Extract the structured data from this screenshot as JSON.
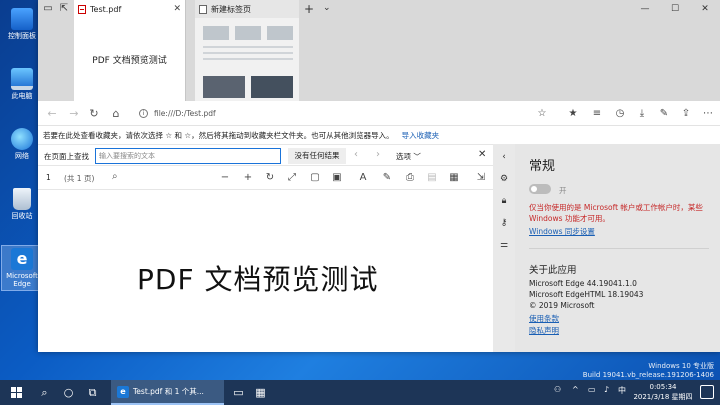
{
  "desktop": {
    "icons": [
      {
        "label": "控制面板",
        "icon": "control-panel-icon"
      },
      {
        "label": "此电脑",
        "icon": "this-pc-icon"
      },
      {
        "label": "网络",
        "icon": "network-icon"
      },
      {
        "label": "回收站",
        "icon": "recycle-bin-icon"
      },
      {
        "label": "Microsoft Edge",
        "icon": "edge-icon"
      }
    ]
  },
  "tabs": [
    {
      "title": "Test.pdf",
      "preview_text": "PDF 文档预览测试"
    },
    {
      "title": "新建标签页"
    }
  ],
  "address": {
    "url": "file:///D:/Test.pdf"
  },
  "favorites_bar": {
    "message": "若要在此处查看收藏夹，请依次选择 ☆ 和 ☆，然后将其拖动到收藏夹栏文件夹。也可从其他浏览器导入。",
    "import_link": "导入收藏夹"
  },
  "find_bar": {
    "label": "在页面上查找",
    "placeholder": "输入要搜索的文本",
    "result": "没有任何结果",
    "options": "选项 ﹀"
  },
  "pdf_toolbar": {
    "page_number": "1",
    "page_total": "(共 1 页)"
  },
  "pdf": {
    "content": "PDF 文档预览测试"
  },
  "settings": {
    "title": "常规",
    "toggle_label": "开",
    "warning": "仅当你使用的是 Microsoft 帐户或工作帐户时，某些 Windows 功能才可用。",
    "sync_link": "Windows 同步设置",
    "about_title": "关于此应用",
    "edge_version": "Microsoft Edge 44.19041.1.0",
    "edgehtml_version": "Microsoft EdgeHTML 18.19043",
    "copyright": "© 2019 Microsoft",
    "terms_link": "使用条款",
    "privacy_link": "隐私声明"
  },
  "watermark": {
    "line1": "Windows 10 专业版",
    "line2": "Build 19041.vb_release.191206-1406"
  },
  "taskbar": {
    "task_label": "Test.pdf 和 1 个其...",
    "time": "0:05:34",
    "date": "2021/3/18 星期四",
    "ime": "中"
  }
}
